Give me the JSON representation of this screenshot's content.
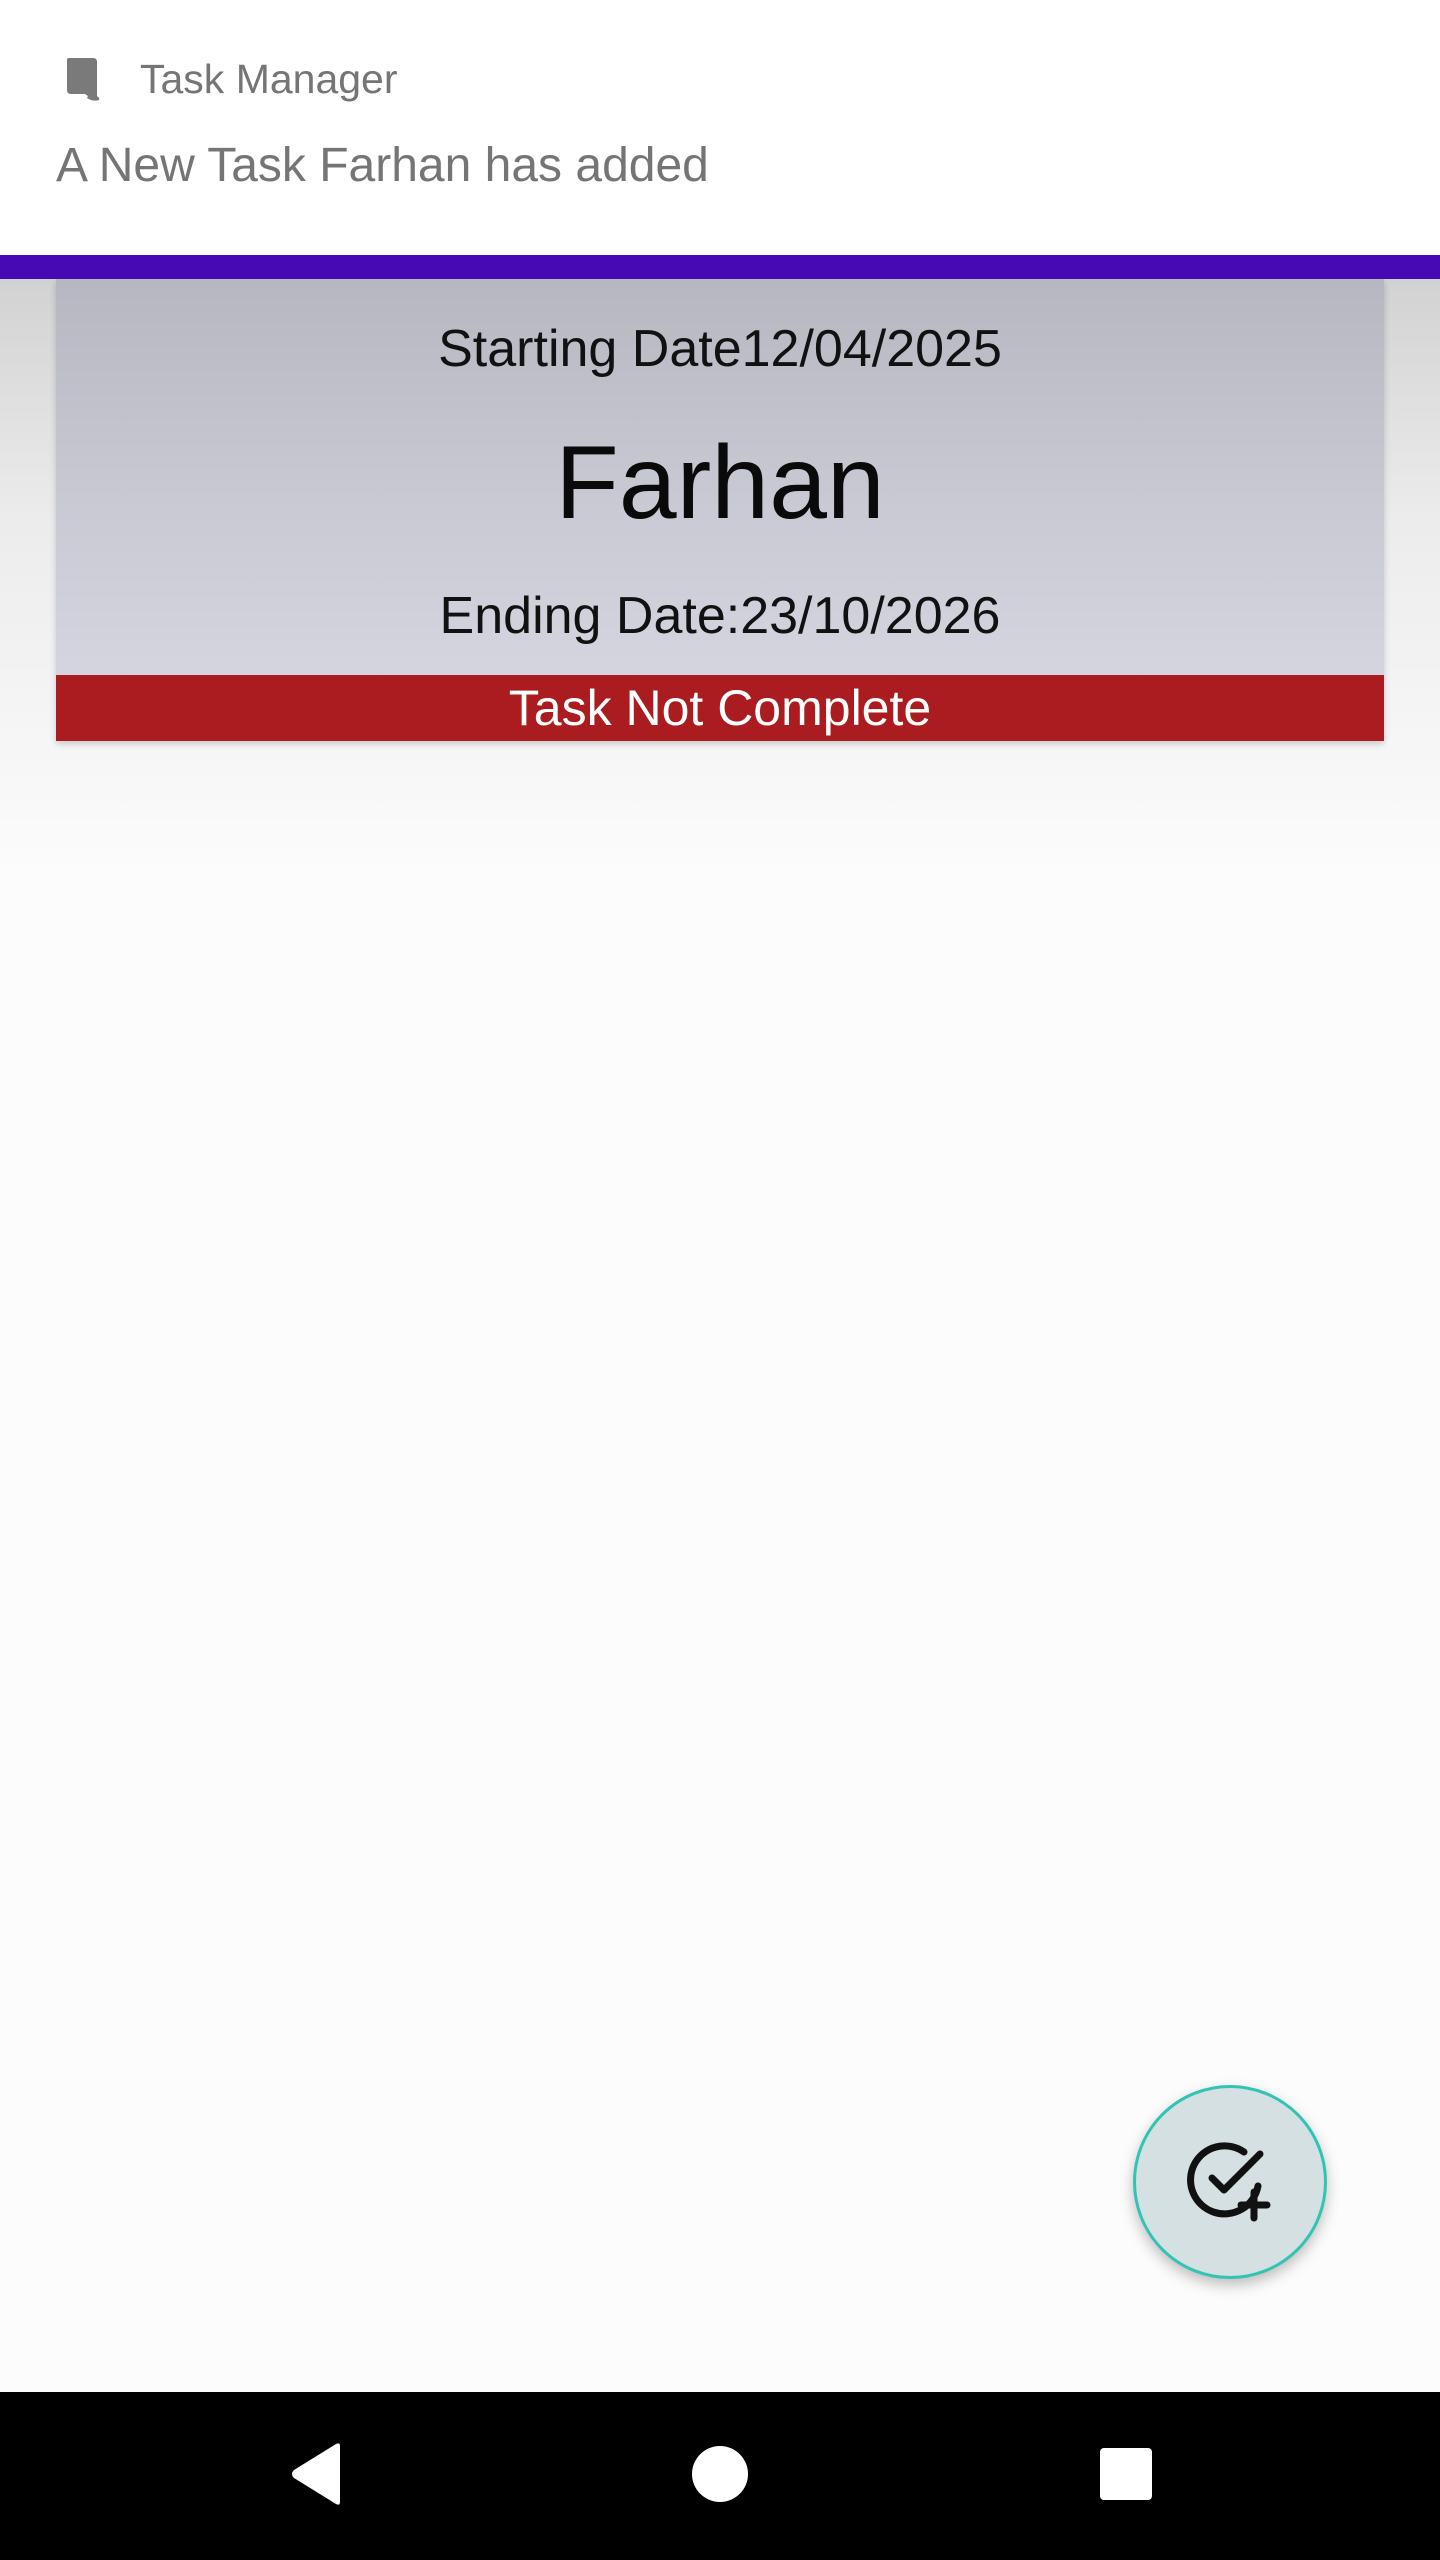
{
  "notification": {
    "app_name": "Task Manager",
    "message": "A New Task Farhan has added",
    "icon": "bookmark-icon"
  },
  "theme": {
    "appbar_color": "#4609b3",
    "status_not_complete_color": "#aa1c1f",
    "fab_border_color": "#31c4b5"
  },
  "task": {
    "start_date": "Starting Date12/04/2025",
    "title": "Farhan",
    "end_date": "Ending Date:23/10/2026",
    "status": "Task Not Complete"
  },
  "fab": {
    "icon": "add-task-icon"
  },
  "navbar": {
    "back_icon": "back-triangle-icon",
    "home_icon": "home-circle-icon",
    "recents_icon": "recents-square-icon"
  }
}
